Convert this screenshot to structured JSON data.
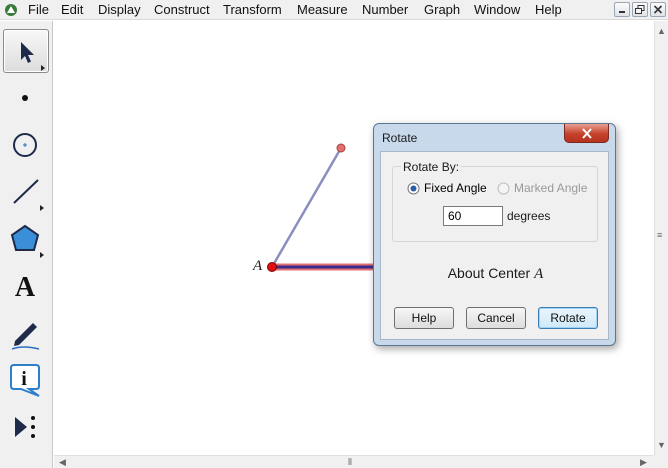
{
  "menubar": {
    "items": [
      "File",
      "Edit",
      "Display",
      "Construct",
      "Transform",
      "Measure",
      "Number",
      "Graph",
      "Window",
      "Help"
    ],
    "app_icon": "sketchpad-app-icon",
    "window_controls": [
      "minimize-icon",
      "restore-icon",
      "close-icon"
    ]
  },
  "toolbox": {
    "tools": [
      {
        "name": "arrow-select-tool",
        "icon": "arrow-cursor-icon",
        "selected": true
      },
      {
        "name": "point-tool",
        "icon": "point-icon"
      },
      {
        "name": "compass-tool",
        "icon": "compass-circle-icon"
      },
      {
        "name": "straightedge-tool",
        "icon": "line-segment-icon"
      },
      {
        "name": "polygon-tool",
        "icon": "polygon-icon"
      },
      {
        "name": "text-tool",
        "icon": "text-icon",
        "glyph": "A"
      },
      {
        "name": "marker-tool",
        "icon": "marker-pen-icon"
      },
      {
        "name": "information-tool",
        "icon": "info-icon",
        "glyph": "i"
      },
      {
        "name": "custom-tool",
        "icon": "custom-tool-icon"
      }
    ]
  },
  "canvas": {
    "point_label": "A",
    "colors": {
      "point": "#e01010",
      "segment_rotated": "#8a8fc0",
      "segment_selected": "#3a2a90",
      "highlight": "#e07070"
    }
  },
  "dialog": {
    "title": "Rotate",
    "group_label": "Rotate By:",
    "options": {
      "fixed": {
        "label": "Fixed Angle",
        "selected": true
      },
      "marked": {
        "label": "Marked Angle",
        "enabled": false
      }
    },
    "angle_value": "60",
    "angle_units": "degrees",
    "center_prefix": "About Center",
    "center_point": "A",
    "buttons": {
      "help": "Help",
      "cancel": "Cancel",
      "rotate": "Rotate"
    }
  }
}
